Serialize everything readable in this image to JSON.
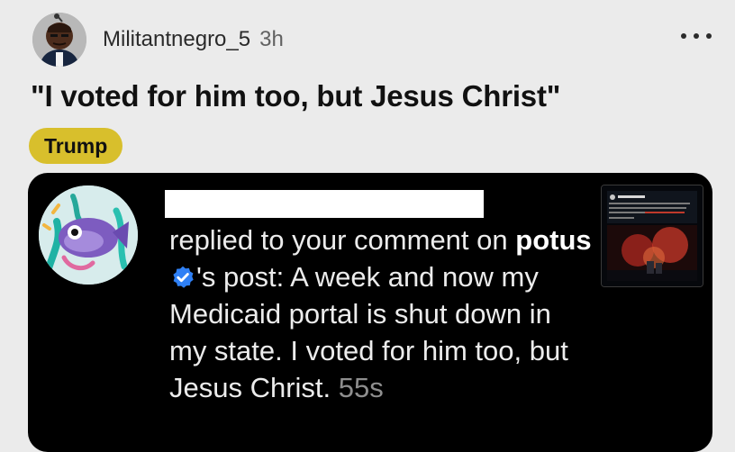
{
  "post": {
    "username": "Militantnegro_5",
    "time_ago": "3h",
    "title": "\"I voted for him too, but Jesus Christ\"",
    "flair": "Trump"
  },
  "embed": {
    "notification": {
      "action_text": "replied to your comment on",
      "account_handle": "potus",
      "message_text": "'s post: A week and now my Medicaid portal is shut down in my state. I voted for him too, but Jesus Christ.",
      "time": "55s"
    }
  },
  "icons": {
    "more": "more-options-icon",
    "verified": "verified-badge-icon"
  },
  "colors": {
    "page_background": "#ebebeb",
    "flair_background": "#d8bf2c",
    "embed_background": "#000000",
    "verified_blue": "#2f80f5"
  }
}
